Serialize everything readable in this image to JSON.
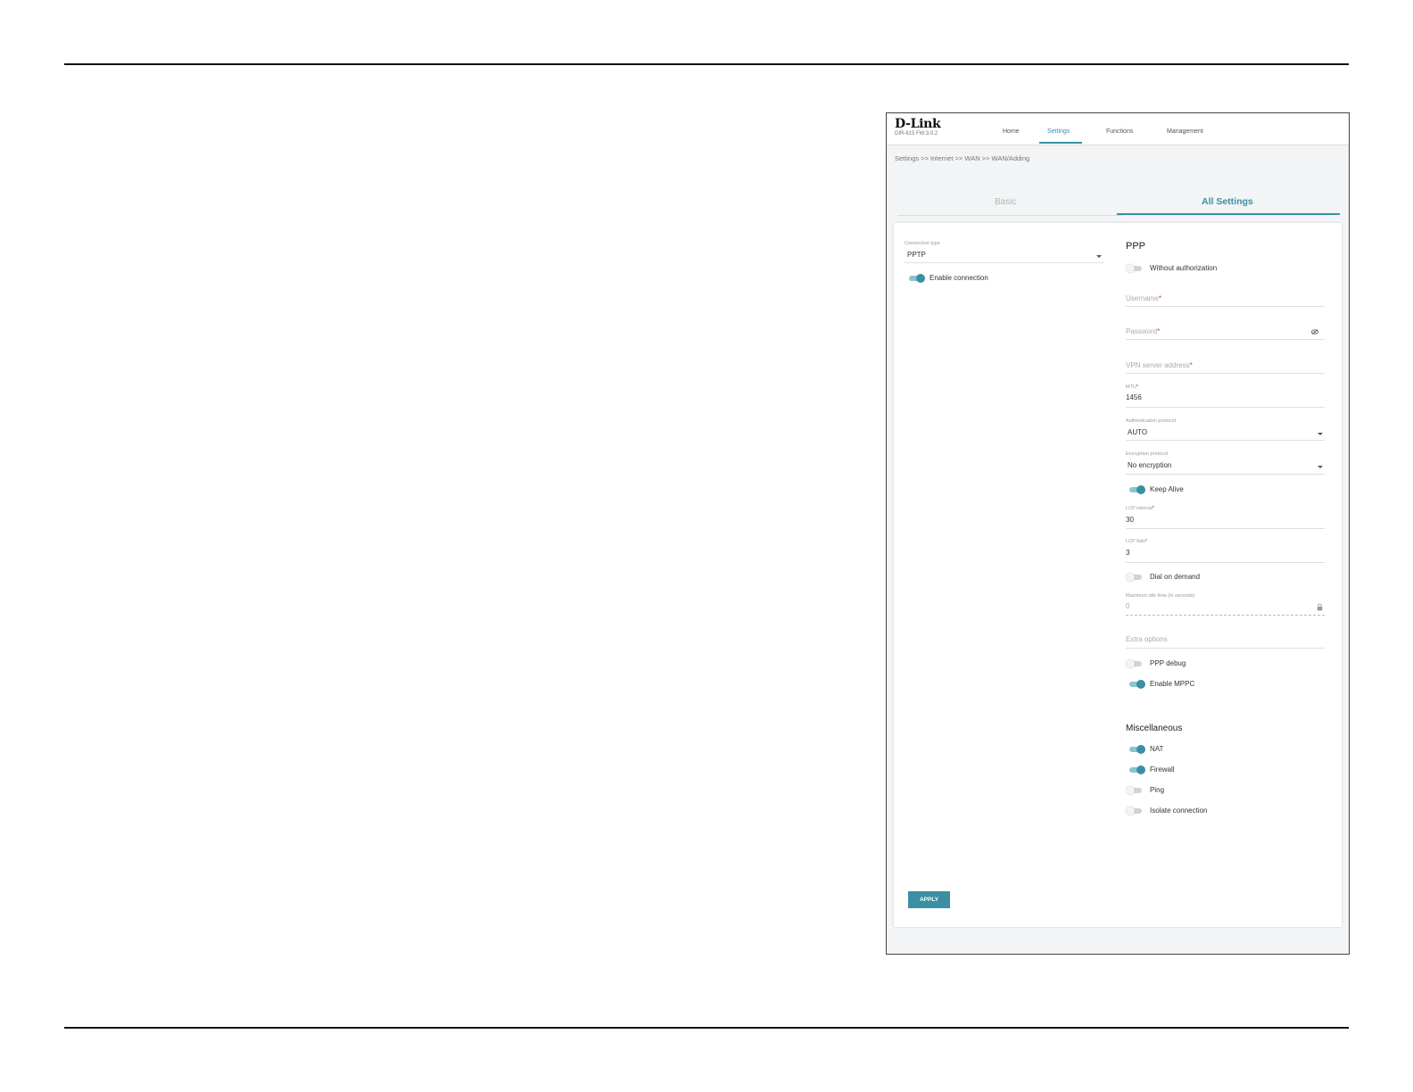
{
  "header": {
    "logo": "D-Link",
    "model": "DIR-615 FW:3.0.2",
    "nav": [
      {
        "label": "Home",
        "active": false
      },
      {
        "label": "Settings",
        "active": true
      },
      {
        "label": "Functions",
        "active": false
      },
      {
        "label": "Management",
        "active": false
      }
    ]
  },
  "breadcrumb": "Settings >> Internet >> WAN >> WAN/Adding",
  "tabs": {
    "basic": "Basic",
    "all": "All Settings",
    "active": "all"
  },
  "left": {
    "connection_type_label": "Connection type",
    "connection_type_value": "PPTP",
    "enable_connection": {
      "label": "Enable connection",
      "on": true
    }
  },
  "ppp": {
    "title": "PPP",
    "without_authorization": {
      "label": "Without authorization",
      "on": false
    },
    "username_placeholder": "Username",
    "password_placeholder": "Password",
    "vpn_server_placeholder": "VPN server address",
    "mtu_label": "MTU",
    "mtu_value": "1456",
    "auth_protocol_label": "Authentication protocol",
    "auth_protocol_value": "AUTO",
    "encryption_protocol_label": "Encryption protocol",
    "encryption_protocol_value": "No encryption",
    "keep_alive": {
      "label": "Keep Alive",
      "on": true
    },
    "lcp_interval_label": "LCP interval",
    "lcp_interval_value": "30",
    "lcp_fails_label": "LCP fails",
    "lcp_fails_value": "3",
    "dial_on_demand": {
      "label": "Dial on demand",
      "on": false
    },
    "max_idle_label": "Maximum idle time (in seconds)",
    "max_idle_value": "0",
    "extra_options_placeholder": "Extra options",
    "ppp_debug": {
      "label": "PPP debug",
      "on": false
    },
    "enable_mppc": {
      "label": "Enable MPPC",
      "on": true
    }
  },
  "misc": {
    "title": "Miscellaneous",
    "nat": {
      "label": "NAT",
      "on": true
    },
    "firewall": {
      "label": "Firewall",
      "on": true
    },
    "ping": {
      "label": "Ping",
      "on": false
    },
    "isolate": {
      "label": "Isolate connection",
      "on": false
    }
  },
  "required_mark": "*",
  "apply_label": "APPLY",
  "colors": {
    "accent": "#3a8fa3",
    "required": "#dd3333"
  }
}
